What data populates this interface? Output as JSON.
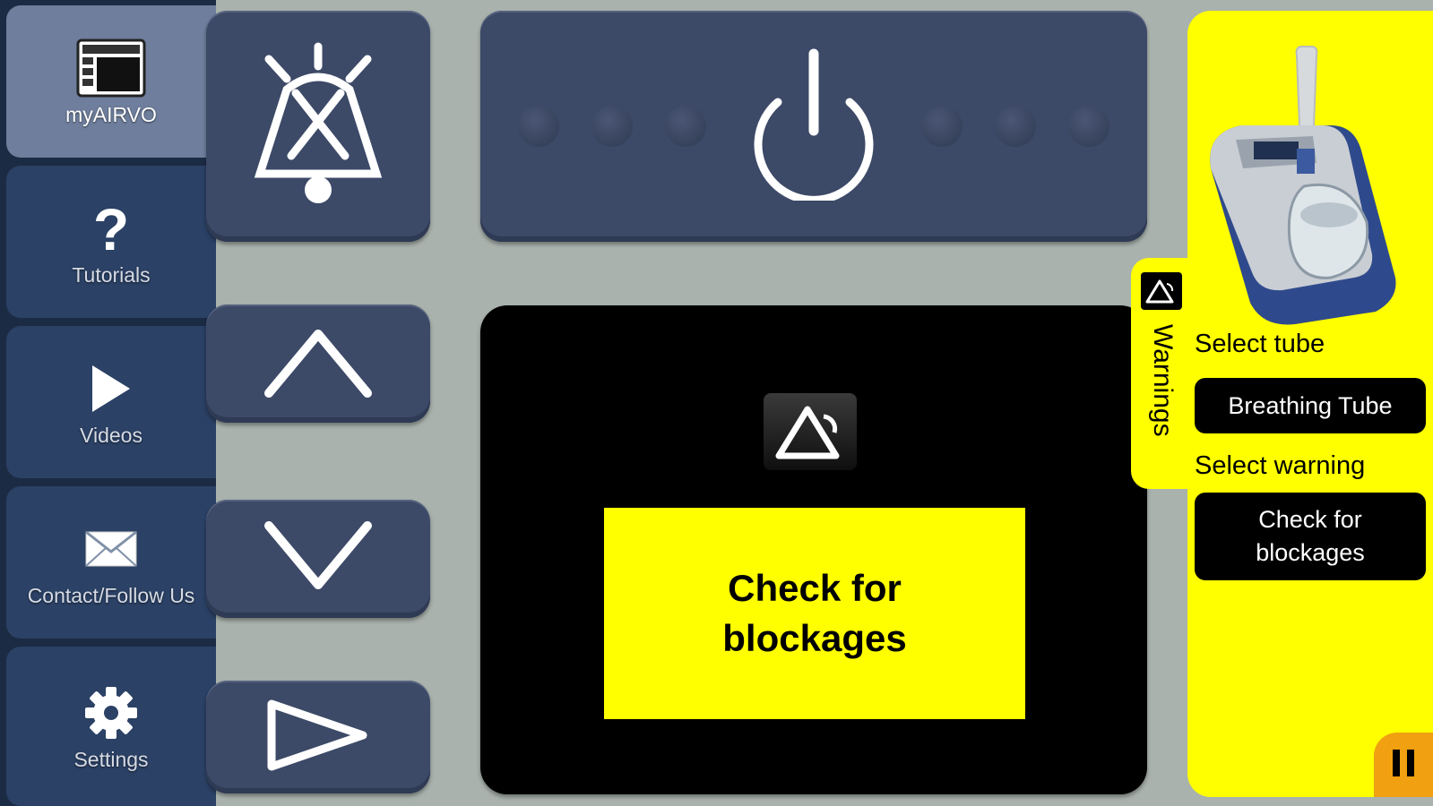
{
  "sidebar": {
    "items": [
      {
        "label": "myAIRVO",
        "icon": "dashboard-icon",
        "active": true
      },
      {
        "label": "Tutorials",
        "icon": "question-icon",
        "active": false
      },
      {
        "label": "Videos",
        "icon": "play-icon",
        "active": false
      },
      {
        "label": "Contact/Follow Us",
        "icon": "envelope-icon",
        "active": false
      },
      {
        "label": "Settings",
        "icon": "gear-icon",
        "active": false
      }
    ]
  },
  "controls": {
    "alarm_mute_icon": "alarm-mute-icon",
    "power_icon": "power-icon",
    "up_icon": "chevron-up-icon",
    "down_icon": "chevron-down-icon",
    "mode_icon": "play-triangle-icon"
  },
  "screen": {
    "warning_icon": "warning-triangle-icon",
    "message": "Check for\nblockages"
  },
  "right_panel": {
    "tab_label": "Warnings",
    "select_tube_label": "Select tube",
    "tube_value": "Breathing Tube",
    "select_warning_label": "Select warning",
    "warning_value": "Check for\nblockages",
    "pause_icon": "pause-icon"
  },
  "colors": {
    "accent_yellow": "#ffff00",
    "sidebar_bg": "#1c2b44",
    "button_bg": "#3c4967",
    "pause_orange": "#f0a010"
  }
}
